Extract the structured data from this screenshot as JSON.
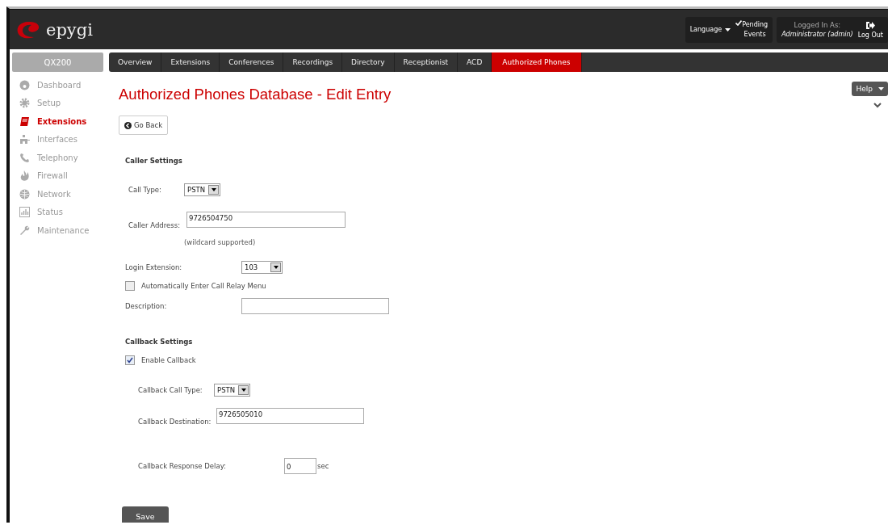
{
  "header": {
    "logo": "epygi",
    "language": "Language",
    "pending": "Pending\nEvents",
    "logged_in_label": "Logged In As:",
    "logged_in_user": "Administrator (admin)",
    "logout": "Log Out"
  },
  "device": "QX200",
  "tabs": [
    {
      "label": "Overview",
      "selected": false
    },
    {
      "label": "Extensions",
      "selected": false
    },
    {
      "label": "Conferences",
      "selected": false
    },
    {
      "label": "Recordings",
      "selected": false
    },
    {
      "label": "Directory",
      "selected": false
    },
    {
      "label": "Receptionist",
      "selected": false
    },
    {
      "label": "ACD",
      "selected": false
    },
    {
      "label": "Authorized Phones",
      "selected": true
    }
  ],
  "sidebar": {
    "items": [
      {
        "label": "Dashboard",
        "selected": false
      },
      {
        "label": "Setup",
        "selected": false
      },
      {
        "label": "Extensions",
        "selected": true
      },
      {
        "label": "Interfaces",
        "selected": false
      },
      {
        "label": "Telephony",
        "selected": false
      },
      {
        "label": "Firewall",
        "selected": false
      },
      {
        "label": "Network",
        "selected": false
      },
      {
        "label": "Status",
        "selected": false
      },
      {
        "label": "Maintenance",
        "selected": false
      }
    ]
  },
  "help": "Help",
  "title": "Authorized Phones Database - Edit Entry",
  "go_back": "Go Back",
  "caller_settings": {
    "heading": "Caller Settings",
    "call_type": {
      "label": "Call Type:",
      "value": "PSTN"
    },
    "caller_address": {
      "label": "Caller Address:",
      "value": "9726504750",
      "hint": "(wildcard supported)"
    },
    "login_extension": {
      "label": "Login Extension:",
      "value": "103"
    },
    "auto_relay": {
      "label": "Automatically Enter Call Relay Menu",
      "checked": false
    },
    "description": {
      "label": "Description:"
    }
  },
  "callback_settings": {
    "heading": "Callback Settings",
    "enable": {
      "label": "Enable Callback",
      "checked": true
    },
    "call_type": {
      "label": "Callback Call Type:",
      "value": "PSTN"
    },
    "destination": {
      "label": "Callback Destination:",
      "value": "9726505010"
    },
    "delay": {
      "label": "Callback Response Delay:",
      "value": "0",
      "unit": "sec"
    }
  },
  "save": "Save"
}
